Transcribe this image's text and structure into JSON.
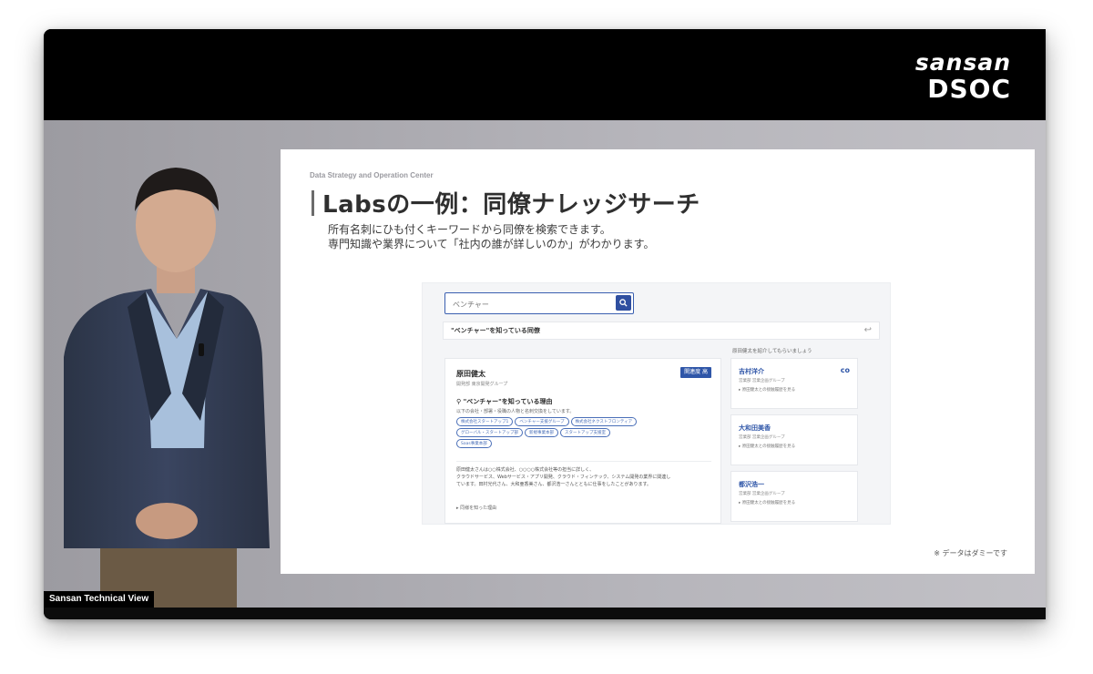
{
  "window": {
    "logo_line1": "sansan",
    "logo_line2": "DSOC",
    "caption": "Sansan Technical View"
  },
  "slide": {
    "header": "Data Strategy and Operation Center",
    "title": "Labsの一例：同僚ナレッジサーチ",
    "subtitle_line1": "所有名刺にひも付くキーワードから同僚を検索できます。",
    "subtitle_line2": "専門知識や業界について「社内の誰が詳しいのか」がわかります。",
    "footnote": "※ データはダミーです"
  },
  "app": {
    "search_placeholder": "ベンチャー",
    "result_title": "\"ベンチャー\"を知っている同僚",
    "back_icon": "↩",
    "main_card": {
      "name": "原田健太",
      "dept": "開発部 東京開発グループ",
      "connect_label": "関連度 高",
      "reason_title": "\"ベンチャー\"を知っている理由",
      "reason_desc": "以下の会社・部署・役職の人物と名刺交換をしています。",
      "tags": [
        "株式会社スタートアップ1",
        "ベンチャー支援グループ",
        "株式会社ネクストフロンティア",
        "グローバル・スタートアップ部",
        "新規事業本部",
        "スタートアップ支援室",
        "Saas事業本部"
      ],
      "text_line1": "原田健太さんは○○株式会社、○○○○株式会社等の担当に詳しく、",
      "text_line2": "クラウドサービス、Webサービス・アプリ開発、クラウド・フィンテック、システム開発の業界に関連し",
      "text_line3": "ています。田村光代さん、大和亜香美さん、都沢浩一さんとともに仕事をしたことがあります。",
      "link": "▸ 同様を知った理由"
    },
    "side_head": "原田健太を紹介してもらいましょう",
    "side_cards": [
      {
        "name": "吉村洋介",
        "dept": "営業部 営業企画グループ",
        "link": "▸ 原田健太との接触履歴を見る",
        "icon": "co"
      },
      {
        "name": "大和田美香",
        "dept": "営業部 営業企画グループ",
        "link": "▸ 原田健太との接触履歴を見る",
        "icon": ""
      },
      {
        "name": "都沢浩一",
        "dept": "営業部 営業企画グループ",
        "link": "▸ 原田健太との接触履歴を見る",
        "icon": ""
      }
    ]
  }
}
